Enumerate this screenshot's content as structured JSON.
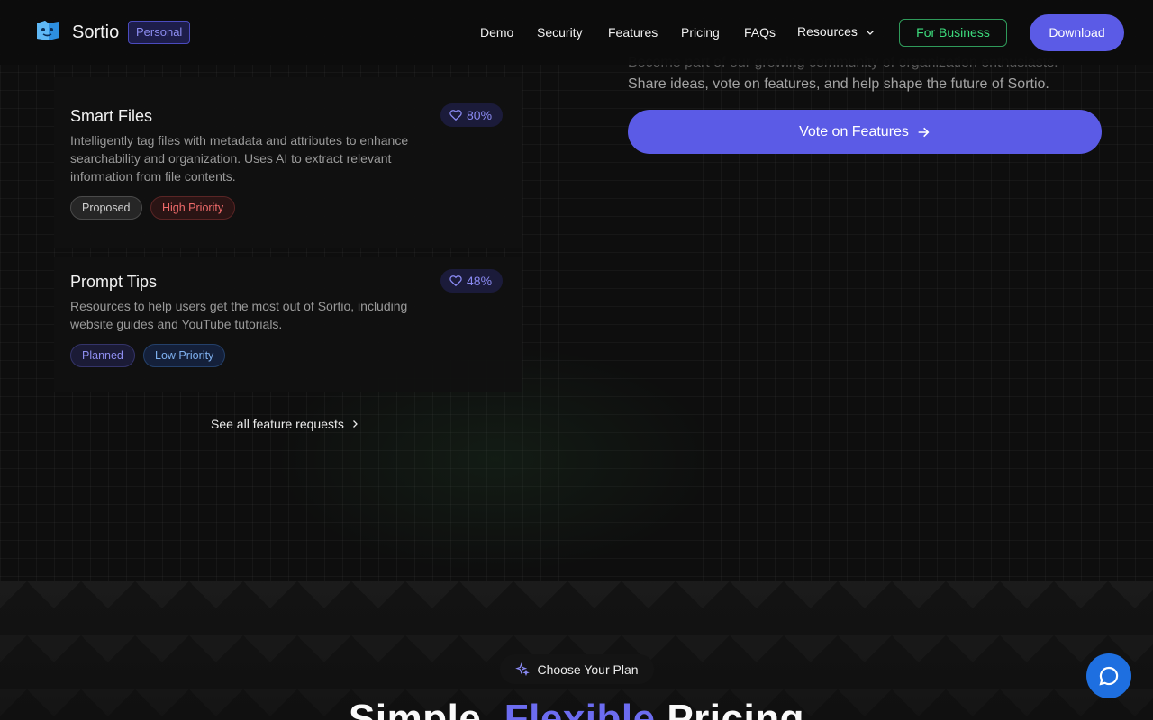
{
  "header": {
    "brand": "Sortio",
    "badge": "Personal",
    "nav": [
      "Demo",
      "Security",
      "Features",
      "Pricing",
      "FAQs",
      "Resources"
    ],
    "business_label": "For Business",
    "download_label": "Download"
  },
  "features": [
    {
      "title": "Smart Files",
      "desc": "Intelligently tag files with metadata and attributes to enhance searchability and organization. Uses AI to extract relevant information from file contents.",
      "votes": "80%",
      "status": "Proposed",
      "priority": "High Priority"
    },
    {
      "title": "Prompt Tips",
      "desc": "Resources to help users get the most out of Sortio, including website guides and YouTube tutorials.",
      "votes": "48%",
      "status": "Planned",
      "priority": "Low Priority"
    }
  ],
  "see_all_label": "See all feature requests",
  "community": {
    "line1": "Become part of our growing community of organization enthusiasts.",
    "line2": "Share ideas, vote on features, and help shape the future of Sortio.",
    "vote_label": "Vote on Features"
  },
  "pricing": {
    "pill": "Choose Your Plan",
    "title_a": "Simple,",
    "title_b": "Flexible",
    "title_c": "Pricing"
  },
  "colors": {
    "accent": "#5b5be6",
    "business_green": "#3ddc7d",
    "chat_blue": "#1e6fe0"
  }
}
